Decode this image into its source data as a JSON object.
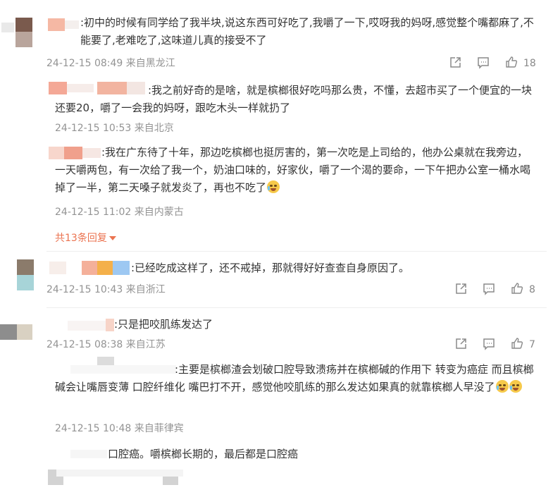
{
  "comments": [
    {
      "text": ":初中的时候有同学给了我半块,说这东西可好吃了,我嚼了一下,哎呀我的妈呀,感觉整个嘴都麻了,不能要了,老难吃了,这味道儿真的接受不了",
      "meta": "24-12-15 08:49 来自黑龙江",
      "likes": "18",
      "replies": [
        {
          "text": ":我之前好奇的是啥，就是槟榔很好吃吗那么贵，不懂，去超市买了一个便宜的一块还要20，嚼了一会我的妈呀，跟吃木头一样就扔了",
          "meta": "24-12-15 10:53 来自北京"
        },
        {
          "text": ":我在广东待了十年，那边吃槟榔也挺厉害的，第一次吃是上司给的，他办公桌就在我旁边，一天嚼两包，有一次给了我一个，奶油口味的，好家伙，嚼了一个渴的要命，一下午把办公室一桶水喝掉了一半，第二天嗓子就发炎了，再也不吃了",
          "meta": "24-12-15 11:02 来自内蒙古"
        }
      ],
      "more_replies": "共13条回复"
    },
    {
      "text": ":已经吃成这样了，还不戒掉，那就得好好查查自身原因了。",
      "meta": "24-12-15 10:43 来自浙江",
      "likes": "8"
    },
    {
      "text": ":只是把咬肌练发达了",
      "meta": "24-12-15 08:38 来自江苏",
      "likes": "7",
      "replies": [
        {
          "text": ":主要是槟榔渣会划破口腔导致溃疡并在槟榔碱的作用下 转变为癌症  而且槟榔碱会让嘴唇变薄 口腔纤维化 嘴巴打不开，感觉他咬肌练的那么发达如果真的就靠槟榔人早没了",
          "meta": "24-12-15 10:48 来自菲律宾"
        },
        {
          "text": "口腔癌。嚼槟榔长期的，最后都是口腔癌",
          "meta": ""
        }
      ]
    }
  ],
  "icons": {
    "share": "share-icon",
    "comment": "comment-icon",
    "like": "thumbs-up-icon"
  },
  "colors": {
    "accent": "#eb7350",
    "meta": "#939393",
    "text": "#333333"
  }
}
